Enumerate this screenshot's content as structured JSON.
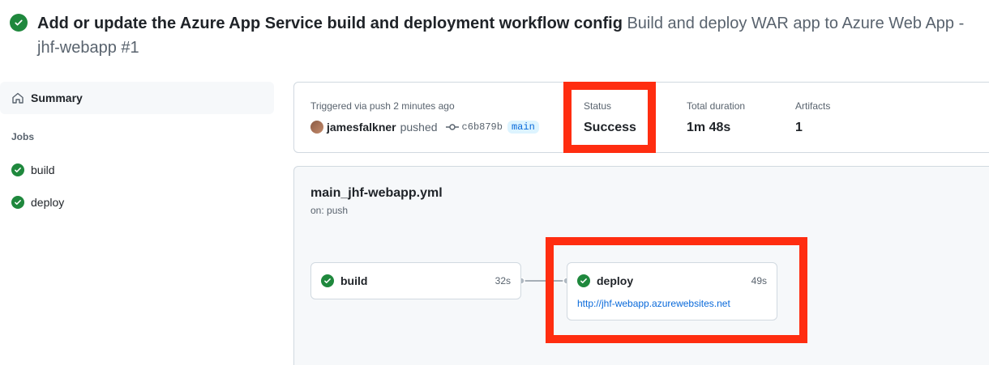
{
  "header": {
    "title": "Add or update the Azure App Service build and deployment workflow config",
    "subtitle": "Build and deploy WAR app to Azure Web App - jhf-webapp #1"
  },
  "sidebar": {
    "summary_label": "Summary",
    "jobs_heading": "Jobs",
    "jobs": [
      {
        "label": "build"
      },
      {
        "label": "deploy"
      }
    ]
  },
  "summary": {
    "trigger_text": "Triggered via push 2 minutes ago",
    "actor": "jamesfalkner",
    "action": "pushed",
    "commit_sha": "c6b879b",
    "branch": "main",
    "status_label": "Status",
    "status_value": "Success",
    "duration_label": "Total duration",
    "duration_value": "1m 48s",
    "artifacts_label": "Artifacts",
    "artifacts_value": "1"
  },
  "workflow": {
    "file": "main_jhf-webapp.yml",
    "trigger": "on: push",
    "jobs": [
      {
        "name": "build",
        "duration": "32s"
      },
      {
        "name": "deploy",
        "duration": "49s",
        "url": "http://jhf-webapp.azurewebsites.net"
      }
    ]
  },
  "colors": {
    "success": "#1f883d",
    "link": "#0969da",
    "annotation": "#ff2d10"
  },
  "icons": {
    "status": "check-circle-fill-icon",
    "summary": "home-icon",
    "commit": "git-commit-icon"
  }
}
